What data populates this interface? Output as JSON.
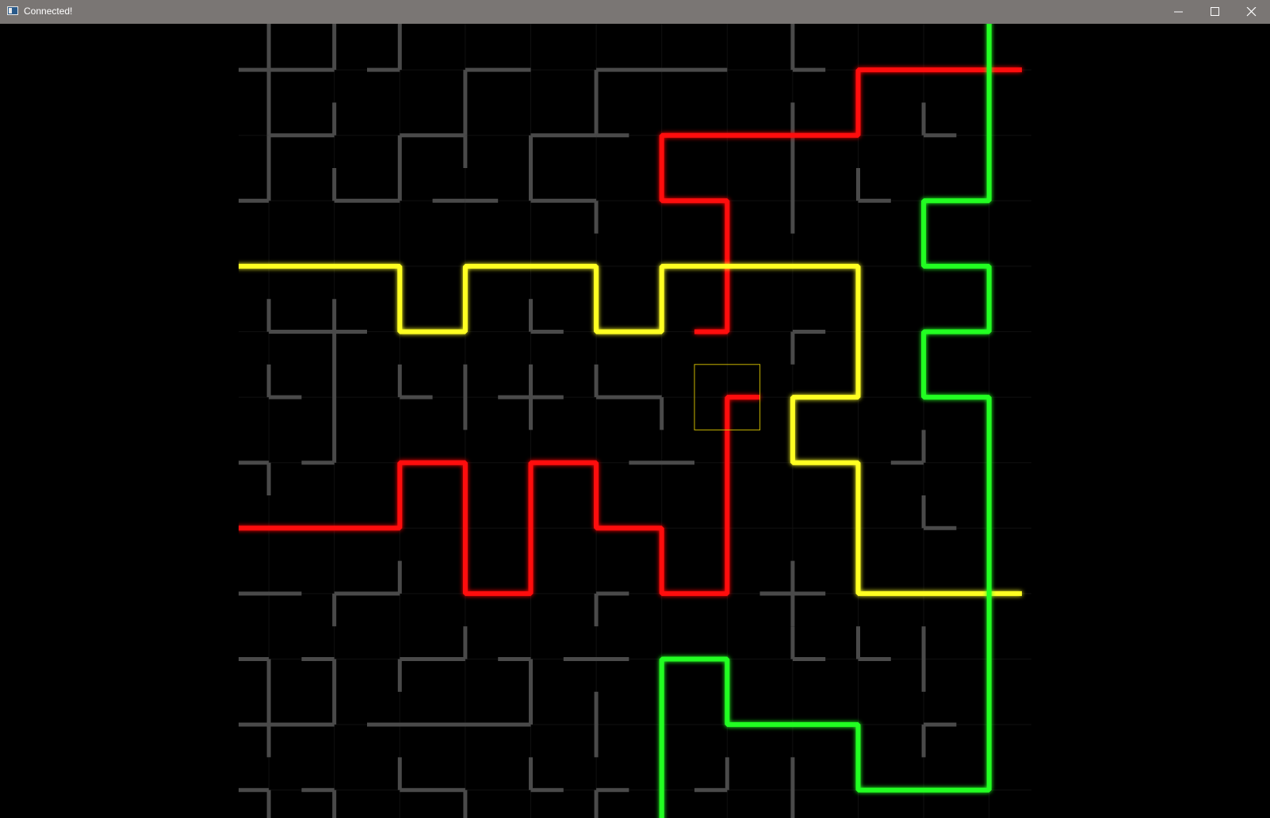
{
  "window": {
    "title": "Connected!",
    "controls": [
      "minimize-icon",
      "maximize-icon",
      "close-icon"
    ]
  },
  "colors": {
    "titlebar": "#7a7674",
    "background": "#000000",
    "gridline": "#101010",
    "inactive_pipe": "#4a4a4a",
    "red_network": "#ff1111",
    "yellow_network": "#ffff22",
    "green_network": "#22ff22",
    "cursor": "#c8b400"
  },
  "board": {
    "columns": 12,
    "rows": 12,
    "cursor_cell": [
      7,
      5
    ],
    "pipes": {
      "gray": [
        [
          [
            4,
            0
          ],
          [
            4,
            1
          ]
        ],
        [
          [
            4,
            1
          ],
          [
            3.5,
            1
          ]
        ],
        [
          [
            4,
            1
          ],
          [
            5,
            1
          ]
        ],
        [
          [
            4,
            1
          ],
          [
            4,
            2
          ]
        ],
        [
          [
            5,
            1
          ],
          [
            5,
            0
          ]
        ],
        [
          [
            6,
            1
          ],
          [
            6,
            0
          ]
        ],
        [
          [
            6,
            1
          ],
          [
            5.5,
            1
          ]
        ],
        [
          [
            7,
            1
          ],
          [
            7,
            2
          ]
        ],
        [
          [
            7,
            1
          ],
          [
            8,
            1
          ]
        ],
        [
          [
            9,
            1
          ],
          [
            9,
            2
          ]
        ],
        [
          [
            9,
            1
          ],
          [
            11,
            1
          ]
        ],
        [
          [
            12,
            0
          ],
          [
            12,
            1
          ]
        ],
        [
          [
            12,
            1
          ],
          [
            12.5,
            1
          ]
        ],
        [
          [
            5,
            2
          ],
          [
            5,
            1.5
          ]
        ],
        [
          [
            5,
            2
          ],
          [
            4,
            2
          ]
        ],
        [
          [
            4,
            2
          ],
          [
            4,
            3
          ]
        ],
        [
          [
            4,
            3
          ],
          [
            3.5,
            3
          ]
        ],
        [
          [
            6,
            2
          ],
          [
            7,
            2
          ]
        ],
        [
          [
            6,
            2
          ],
          [
            6,
            3
          ]
        ],
        [
          [
            6,
            3
          ],
          [
            5,
            3
          ]
        ],
        [
          [
            5,
            3
          ],
          [
            5,
            2.5
          ]
        ],
        [
          [
            7,
            2
          ],
          [
            7,
            2.5
          ]
        ],
        [
          [
            7,
            3
          ],
          [
            7.5,
            3
          ]
        ],
        [
          [
            7,
            3
          ],
          [
            6.5,
            3
          ]
        ],
        [
          [
            8,
            2
          ],
          [
            9,
            2
          ]
        ],
        [
          [
            8,
            2
          ],
          [
            8,
            3
          ]
        ],
        [
          [
            8,
            3
          ],
          [
            9,
            3
          ]
        ],
        [
          [
            9,
            3
          ],
          [
            9,
            3.5
          ]
        ],
        [
          [
            9,
            2
          ],
          [
            9.5,
            2
          ]
        ],
        [
          [
            12,
            1.5
          ],
          [
            12,
            3.5
          ]
        ],
        [
          [
            13,
            2.5
          ],
          [
            13,
            3
          ]
        ],
        [
          [
            13,
            3
          ],
          [
            13.5,
            3
          ]
        ],
        [
          [
            14,
            1.5
          ],
          [
            14,
            2
          ]
        ],
        [
          [
            14,
            2
          ],
          [
            14.5,
            2
          ]
        ],
        [
          [
            4,
            4.5
          ],
          [
            4,
            5
          ]
        ],
        [
          [
            4,
            5
          ],
          [
            5.5,
            5
          ]
        ],
        [
          [
            5,
            4.5
          ],
          [
            5,
            7
          ]
        ],
        [
          [
            5,
            7
          ],
          [
            4.5,
            7
          ]
        ],
        [
          [
            8,
            4.5
          ],
          [
            8,
            5
          ]
        ],
        [
          [
            8,
            5
          ],
          [
            8.5,
            5
          ]
        ],
        [
          [
            12,
            5
          ],
          [
            12.5,
            5
          ]
        ],
        [
          [
            12,
            5
          ],
          [
            12,
            5.5
          ]
        ],
        [
          [
            4,
            5.5
          ],
          [
            4,
            6
          ]
        ],
        [
          [
            4,
            6
          ],
          [
            4.5,
            6
          ]
        ],
        [
          [
            6,
            5.5
          ],
          [
            6,
            6
          ]
        ],
        [
          [
            6,
            6
          ],
          [
            6.5,
            6
          ]
        ],
        [
          [
            7,
            5.5
          ],
          [
            7,
            6.5
          ]
        ],
        [
          [
            8,
            5.5
          ],
          [
            8,
            6.5
          ]
        ],
        [
          [
            7.5,
            6
          ],
          [
            8.5,
            6
          ]
        ],
        [
          [
            9,
            5.5
          ],
          [
            9,
            6
          ]
        ],
        [
          [
            9,
            6
          ],
          [
            10,
            6
          ]
        ],
        [
          [
            10,
            6
          ],
          [
            10,
            6.5
          ]
        ],
        [
          [
            9.5,
            7
          ],
          [
            10.5,
            7
          ]
        ],
        [
          [
            3.5,
            7
          ],
          [
            4,
            7
          ]
        ],
        [
          [
            4,
            7
          ],
          [
            4,
            7.5
          ]
        ],
        [
          [
            14,
            6.5
          ],
          [
            14,
            7
          ]
        ],
        [
          [
            14,
            7
          ],
          [
            13.5,
            7
          ]
        ],
        [
          [
            14,
            7.5
          ],
          [
            14,
            8
          ]
        ],
        [
          [
            14,
            8
          ],
          [
            14.5,
            8
          ]
        ],
        [
          [
            12,
            8.5
          ],
          [
            12,
            9
          ]
        ],
        [
          [
            12,
            9
          ],
          [
            12.5,
            9
          ]
        ],
        [
          [
            12,
            9
          ],
          [
            12,
            9.5
          ]
        ],
        [
          [
            12,
            9
          ],
          [
            11.5,
            9
          ]
        ],
        [
          [
            3.5,
            9
          ],
          [
            4.5,
            9
          ]
        ],
        [
          [
            5,
            9.5
          ],
          [
            5,
            9
          ]
        ],
        [
          [
            5,
            9
          ],
          [
            6,
            9
          ]
        ],
        [
          [
            6,
            9
          ],
          [
            6,
            8.5
          ]
        ],
        [
          [
            9,
            9.5
          ],
          [
            9,
            9
          ]
        ],
        [
          [
            9,
            9
          ],
          [
            9.5,
            9
          ]
        ],
        [
          [
            11.5,
            9
          ],
          [
            12,
            9
          ]
        ],
        [
          [
            12,
            9.5
          ],
          [
            12,
            10
          ]
        ],
        [
          [
            12,
            10
          ],
          [
            12.5,
            10
          ]
        ],
        [
          [
            13,
            9.5
          ],
          [
            13,
            10
          ]
        ],
        [
          [
            13,
            10
          ],
          [
            13.5,
            10
          ]
        ],
        [
          [
            14,
            9.5
          ],
          [
            14,
            10.5
          ]
        ],
        [
          [
            3.5,
            10
          ],
          [
            4,
            10
          ]
        ],
        [
          [
            4,
            10
          ],
          [
            4,
            11.5
          ]
        ],
        [
          [
            4,
            11
          ],
          [
            3.5,
            11
          ]
        ],
        [
          [
            4,
            11
          ],
          [
            5,
            11
          ]
        ],
        [
          [
            4.5,
            10
          ],
          [
            5,
            10
          ]
        ],
        [
          [
            5,
            10
          ],
          [
            5,
            11
          ]
        ],
        [
          [
            7,
            9.5
          ],
          [
            7,
            10
          ]
        ],
        [
          [
            7,
            10
          ],
          [
            6,
            10
          ]
        ],
        [
          [
            6,
            10
          ],
          [
            6,
            10.5
          ]
        ],
        [
          [
            7.5,
            10
          ],
          [
            8,
            10
          ]
        ],
        [
          [
            8,
            10
          ],
          [
            8,
            11
          ]
        ],
        [
          [
            8,
            11
          ],
          [
            5.5,
            11
          ]
        ],
        [
          [
            8.5,
            10
          ],
          [
            9.5,
            10
          ]
        ],
        [
          [
            9,
            10.5
          ],
          [
            9,
            11.5
          ]
        ],
        [
          [
            14,
            11
          ],
          [
            14.5,
            11
          ]
        ],
        [
          [
            14,
            11
          ],
          [
            14,
            11.5
          ]
        ],
        [
          [
            3.5,
            12
          ],
          [
            4,
            12
          ]
        ],
        [
          [
            4,
            12
          ],
          [
            4,
            12.5
          ]
        ],
        [
          [
            4.5,
            12
          ],
          [
            5,
            12
          ]
        ],
        [
          [
            5,
            12
          ],
          [
            5,
            12.5
          ]
        ],
        [
          [
            6,
            11.5
          ],
          [
            6,
            12
          ]
        ],
        [
          [
            6,
            12
          ],
          [
            7,
            12
          ]
        ],
        [
          [
            7,
            12
          ],
          [
            7,
            12.5
          ]
        ],
        [
          [
            8,
            11.5
          ],
          [
            8,
            12
          ]
        ],
        [
          [
            8,
            12
          ],
          [
            8.5,
            12
          ]
        ],
        [
          [
            9,
            12.5
          ],
          [
            9,
            12
          ]
        ],
        [
          [
            9,
            12
          ],
          [
            9.5,
            12
          ]
        ],
        [
          [
            11,
            11.5
          ],
          [
            11,
            12
          ]
        ],
        [
          [
            11,
            12
          ],
          [
            10.5,
            12
          ]
        ],
        [
          [
            12,
            11.5
          ],
          [
            12,
            12.5
          ]
        ]
      ],
      "red": [
        [
          [
            15.5,
            1
          ],
          [
            13,
            1
          ],
          [
            13,
            2
          ],
          [
            10,
            2
          ],
          [
            10,
            3
          ],
          [
            11,
            3
          ],
          [
            11,
            4
          ]
        ],
        [
          [
            11,
            4
          ],
          [
            11,
            5
          ],
          [
            10.5,
            5
          ]
        ],
        [
          [
            3.5,
            8
          ],
          [
            6,
            8
          ],
          [
            6,
            7
          ],
          [
            7,
            7
          ],
          [
            7,
            9
          ],
          [
            8,
            9
          ],
          [
            8,
            7
          ],
          [
            9,
            7
          ],
          [
            9,
            8
          ],
          [
            10,
            8
          ],
          [
            10,
            9
          ],
          [
            11,
            9
          ],
          [
            11,
            6
          ],
          [
            11.5,
            6
          ]
        ]
      ],
      "yellow": [
        [
          [
            3.5,
            4
          ],
          [
            6,
            4
          ],
          [
            6,
            5
          ],
          [
            7,
            5
          ],
          [
            7,
            4
          ],
          [
            9,
            4
          ],
          [
            9,
            5
          ],
          [
            10,
            5
          ],
          [
            10,
            4
          ],
          [
            13,
            4
          ],
          [
            13,
            6
          ],
          [
            12,
            6
          ],
          [
            12,
            7
          ],
          [
            13,
            7
          ],
          [
            13,
            9
          ],
          [
            15.5,
            9
          ]
        ]
      ],
      "green": [
        [
          [
            15,
            0
          ],
          [
            15,
            3
          ],
          [
            14,
            3
          ],
          [
            14,
            4
          ],
          [
            15,
            4
          ],
          [
            15,
            5
          ],
          [
            14,
            5
          ],
          [
            14,
            6
          ],
          [
            15,
            6
          ],
          [
            15,
            12
          ],
          [
            13,
            12
          ],
          [
            13,
            11
          ],
          [
            11,
            11
          ],
          [
            11,
            10
          ],
          [
            10,
            10
          ],
          [
            10,
            12.5
          ]
        ]
      ]
    }
  }
}
